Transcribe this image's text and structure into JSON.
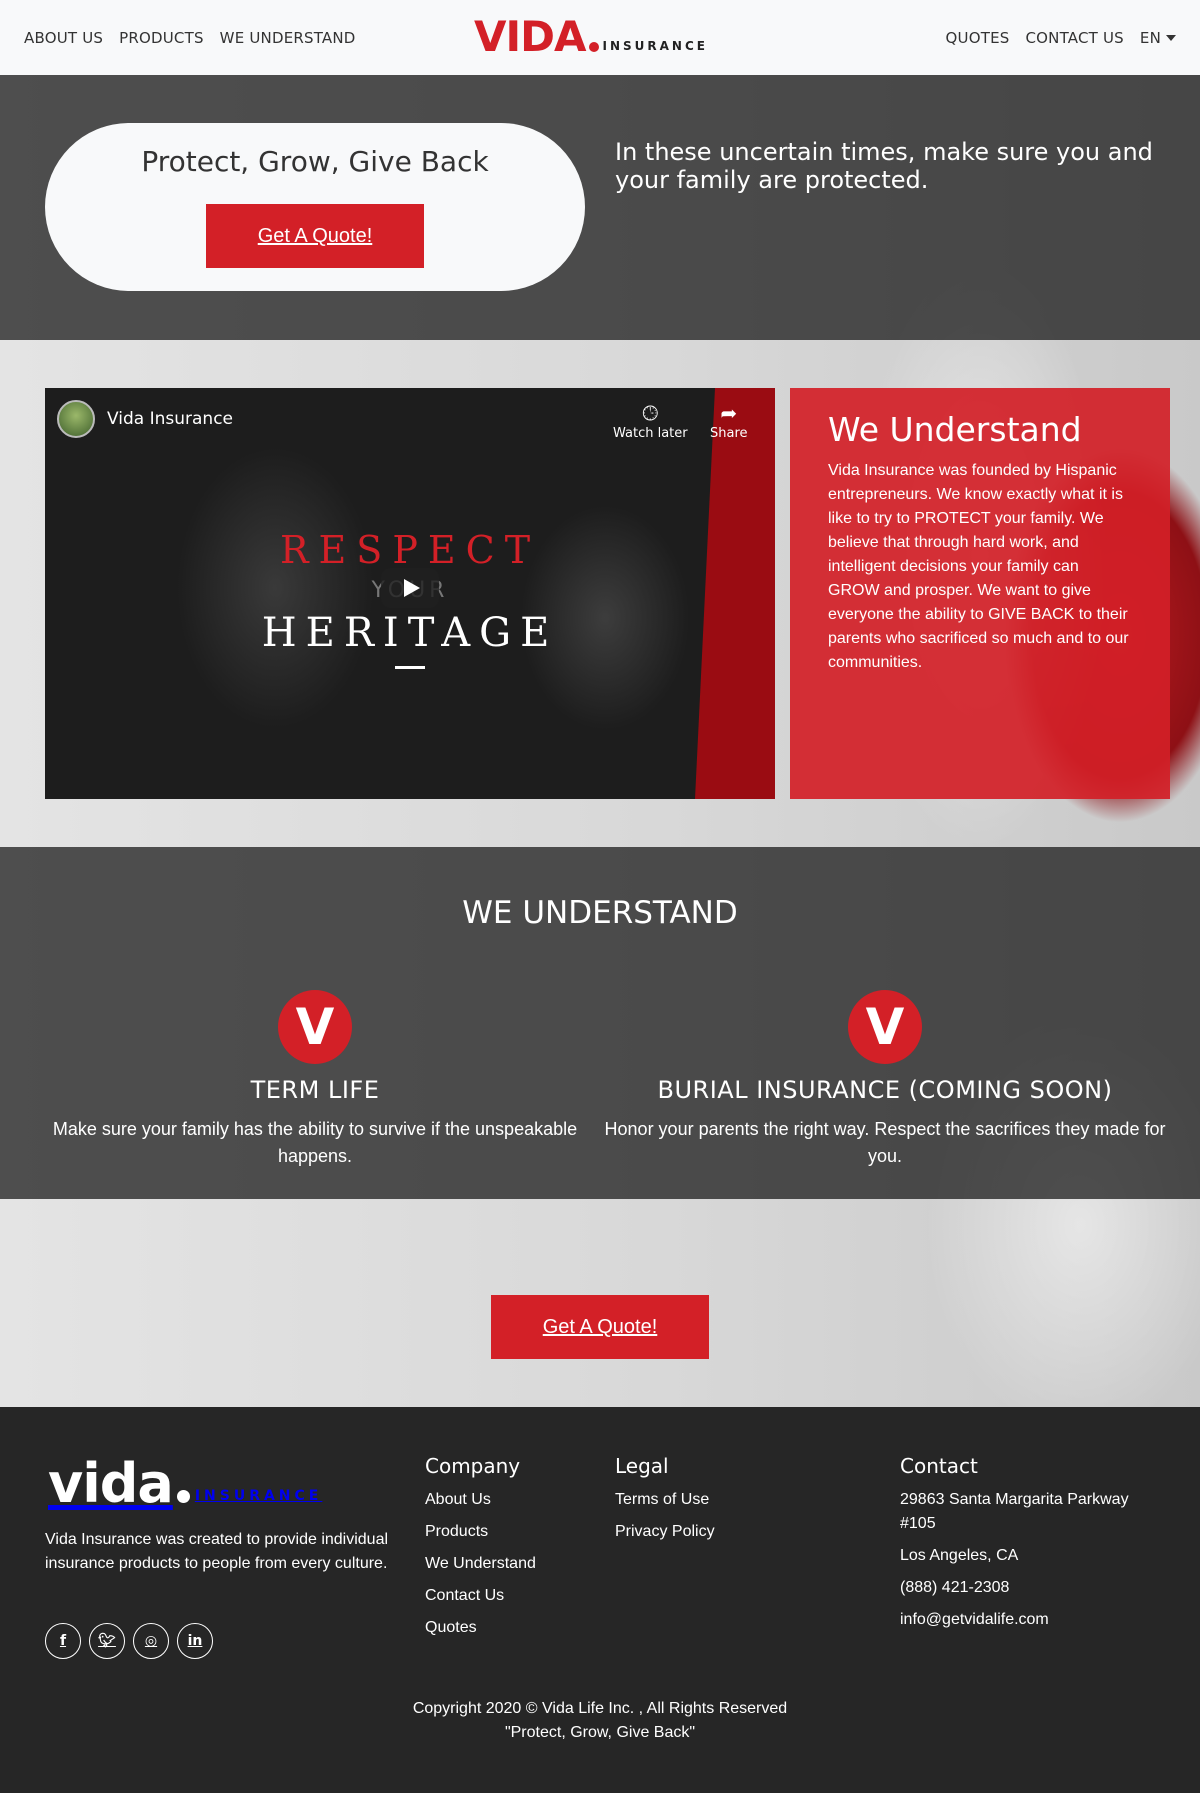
{
  "nav": {
    "left": [
      "ABOUT US",
      "PRODUCTS",
      "WE UNDERSTAND"
    ],
    "right": [
      "QUOTES",
      "CONTACT US"
    ],
    "lang": "EN",
    "logo_word": "vida",
    "logo_sub": "INSURANCE"
  },
  "hero": {
    "heading": "Protect, Grow, Give Back",
    "button": "Get A Quote!",
    "tagline": "In these uncertain times, make sure you and your family are protected."
  },
  "video": {
    "channel": "Vida Insurance",
    "watch_later": "Watch later",
    "share": "Share",
    "title_line1": "RESPECT",
    "title_line2": "YOUR",
    "title_line3": "HERITAGE"
  },
  "card": {
    "title": "We Understand",
    "body": "Vida Insurance was founded by Hispanic entrepreneurs. We know exactly what it is like to try to PROTECT your family. We believe that through hard work, and intelligent decisions your family can GROW and prosper. We want to give everyone the ability to GIVE BACK to their parents who sacrificed so much and to our communities."
  },
  "understand": {
    "title": "WE UNDERSTAND",
    "features": [
      {
        "badge": "V",
        "title": "TERM LIFE",
        "text": "Make sure your family has the ability to survive if the unspeakable happens."
      },
      {
        "badge": "V",
        "title": "BURIAL INSURANCE (COMING SOON)",
        "text": "Honor your parents the right way. Respect the sacrifices they made for you."
      }
    ],
    "cta": "Get A Quote!"
  },
  "footer": {
    "logo_word": "vida",
    "logo_sub": "INSURANCE",
    "about": "Vida Insurance was created to provide individual insurance products to people from every culture.",
    "socials": [
      "facebook-icon",
      "twitter-icon",
      "reddit-icon",
      "linkedin-icon"
    ],
    "company": {
      "title": "Company",
      "links": [
        "About Us",
        "Products",
        "We Understand",
        "Contact Us",
        "Quotes"
      ]
    },
    "legal": {
      "title": "Legal",
      "links": [
        "Terms of Use",
        "Privacy Policy"
      ]
    },
    "contact": {
      "title": "Contact",
      "address1": "29863 Santa Margarita Parkway #105",
      "city": "Los Angeles, CA",
      "phone": "(888) 421-2308",
      "email": "info@getvidalife.com"
    },
    "copyright": "Copyright 2020 © Vida Life Inc. , All Rights Reserved",
    "motto": "\"Protect, Grow, Give Back\""
  },
  "colors": {
    "brand_red": "#d32027",
    "footer_bg": "#262626",
    "nav_bg": "#f8f9fa"
  }
}
